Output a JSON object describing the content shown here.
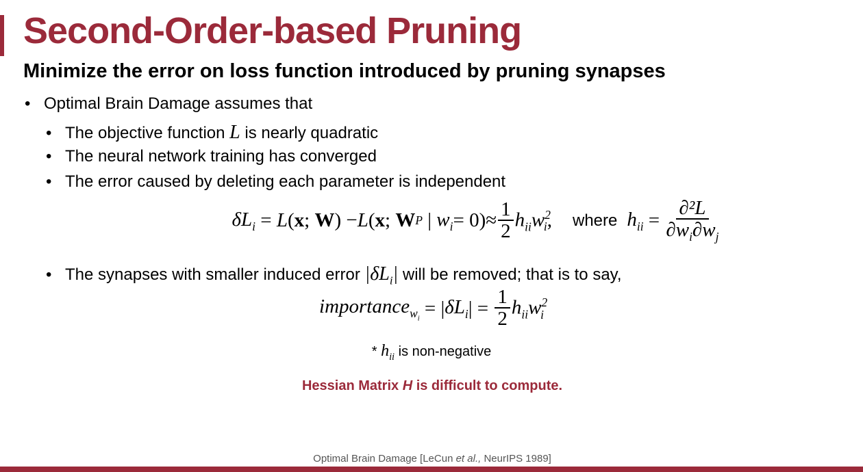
{
  "slide": {
    "title": "Second-Order-based Pruning",
    "subtitle": "Minimize the error on loss function introduced by pruning synapses",
    "bullets": {
      "obd": "Optimal Brain Damage assumes that",
      "quad_pre": "The objective function ",
      "quad_var": "L",
      "quad_post": " is nearly quadratic",
      "converged": "The neural network training has converged",
      "independent": "The error caused by deleting each parameter is independent",
      "removed_pre": "The synapses with smaller induced error ",
      "removed_post": " will be removed; that is to say,"
    },
    "equations": {
      "delta_L": "δL",
      "i": "i",
      "L": "L",
      "x": "x",
      "W": "W",
      "WP_sub": "P",
      "w": "w",
      "eq_zero": " = 0)",
      "approx": " ≈ ",
      "one": "1",
      "two": "2",
      "h": "h",
      "ii": "ii",
      "sq": "2",
      "where": "where",
      "d2L": "∂²L",
      "dwi": "∂w",
      "dwj_sub": "j",
      "importance": "importance"
    },
    "note_pre": "* ",
    "note_post": " is non-negative",
    "warning_pre": "Hessian Matrix ",
    "warning_var": "H",
    "warning_post": " is difficult to compute.",
    "citation_pre": "Optimal Brain Damage [LeCun ",
    "citation_etal": "et al.,",
    "citation_post": " NeurIPS 1989]"
  },
  "colors": {
    "accent": "#9b2a3a",
    "text": "#000000",
    "muted": "#555555"
  }
}
